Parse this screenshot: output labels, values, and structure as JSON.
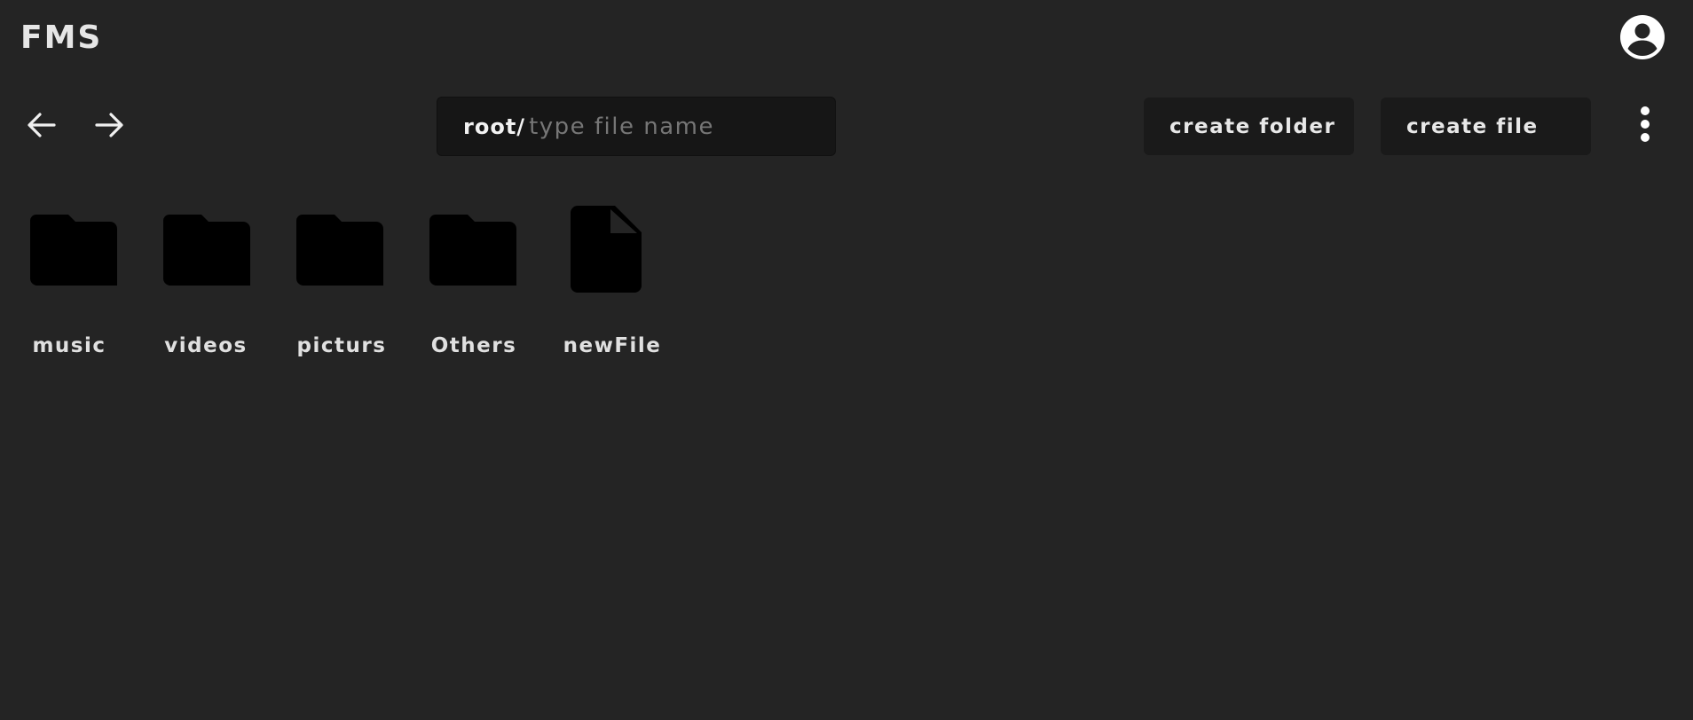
{
  "header": {
    "brand": "FMS",
    "avatar_icon": "account-circle-icon"
  },
  "toolbar": {
    "back_icon": "arrow-left-icon",
    "forward_icon": "arrow-right-icon",
    "path_prefix": "root/",
    "path_input_value": "",
    "path_input_placeholder": "type file name",
    "create_folder_label": "create folder",
    "create_file_label": "create file",
    "more_icon": "more-vertical-icon"
  },
  "items": [
    {
      "name": "music",
      "type": "folder",
      "icon": "folder-icon"
    },
    {
      "name": "videos",
      "type": "folder",
      "icon": "folder-icon"
    },
    {
      "name": "picturs",
      "type": "folder",
      "icon": "folder-icon"
    },
    {
      "name": "Others",
      "type": "folder",
      "icon": "folder-icon"
    },
    {
      "name": "newFile",
      "type": "file",
      "icon": "file-icon"
    }
  ],
  "colors": {
    "background": "#242424",
    "input_background": "#161616",
    "button_background": "#1a1a1a",
    "icon_fill": "#000000",
    "text": "#e8e8e8",
    "placeholder": "#767676"
  }
}
